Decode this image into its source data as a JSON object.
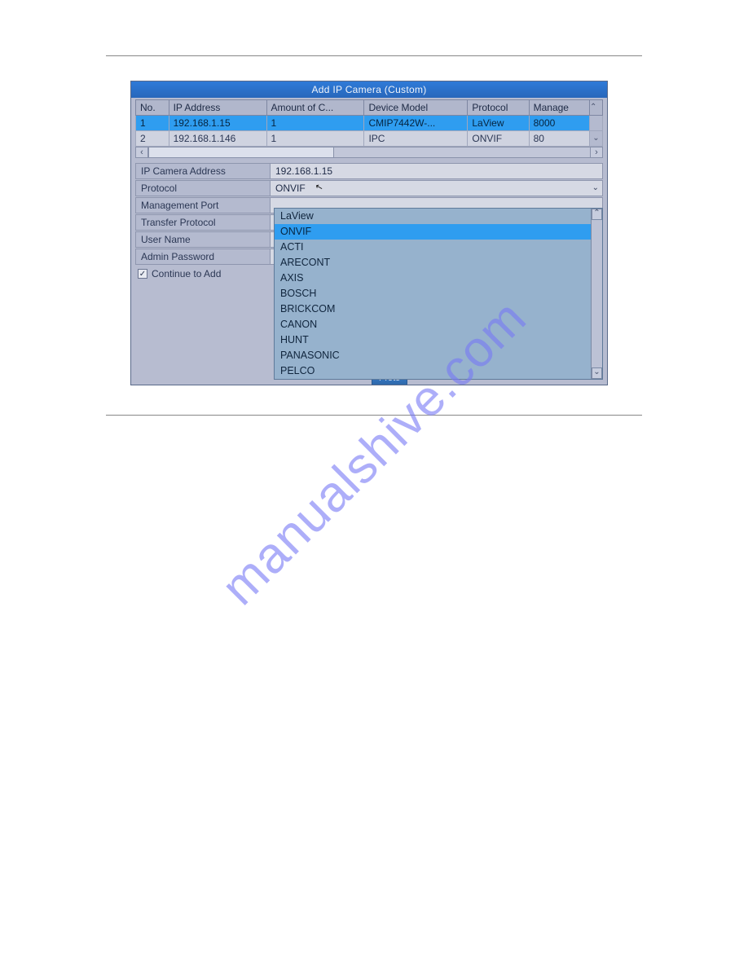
{
  "window": {
    "title": "Add IP Camera (Custom)"
  },
  "table": {
    "headers": [
      "No.",
      "IP Address",
      "Amount of C...",
      "Device Model",
      "Protocol",
      "Manage"
    ],
    "rows": [
      {
        "no": "1",
        "ip": "192.168.1.15",
        "amount": "1",
        "model": "CMIP7442W-...",
        "protocol": "LaView",
        "manage": "8000",
        "selected": true
      },
      {
        "no": "2",
        "ip": "192.168.1.146",
        "amount": "1",
        "model": "IPC",
        "protocol": "ONVIF",
        "manage": "80",
        "selected": false
      }
    ]
  },
  "form": {
    "ip_address": {
      "label": "IP Camera Address",
      "value": "192.168.1.15"
    },
    "protocol": {
      "label": "Protocol",
      "value": "ONVIF"
    },
    "mgmt_port": {
      "label": "Management Port",
      "value": ""
    },
    "transfer_proto": {
      "label": "Transfer Protocol",
      "value": ""
    },
    "user_name": {
      "label": "User Name",
      "value": ""
    },
    "admin_password": {
      "label": "Admin Password",
      "value": ""
    }
  },
  "dropdown": {
    "options": [
      "LaView",
      "ONVIF",
      "ACTI",
      "ARECONT",
      "AXIS",
      "BOSCH",
      "BRICKCOM",
      "CANON",
      "HUNT",
      "PANASONIC",
      "PELCO"
    ],
    "selected": "ONVIF"
  },
  "continue_to_add": {
    "label": "Continue to Add",
    "checked": true
  },
  "bottom_button": {
    "label": "Proto"
  },
  "watermark": "manualshive.com"
}
